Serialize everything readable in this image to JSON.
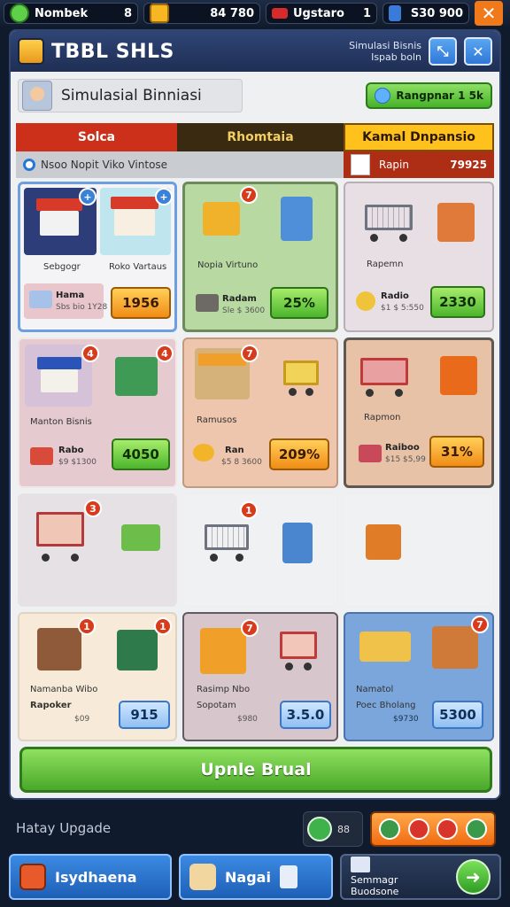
{
  "topbar": {
    "resource1": {
      "label": "Nombek",
      "value": "8"
    },
    "resource2": {
      "value": "84 780"
    },
    "resource3": {
      "label": "Ugstaro",
      "value": "1"
    },
    "resource4": {
      "value": "S30 900"
    },
    "close_glyph": "✕"
  },
  "header": {
    "title": "TBBL SHLS",
    "subtitle_line1": "Simulasi Bisnis",
    "subtitle_line2": "Ispab boln"
  },
  "sim": {
    "title": "Simulasial Binniasi",
    "manage_button": "Rangpnar 1 5k"
  },
  "tabs": [
    "Solca",
    "Rhomtaia",
    "Kamal Dnpansio"
  ],
  "filter": {
    "label": "Nsoo Nopit Viko Vintose"
  },
  "stat": {
    "label": "Rapin",
    "value": "79925"
  },
  "cards": [
    {
      "cap1": "Sebgogr",
      "cap2": "Roko Vartaus",
      "foot_title": "Hama",
      "foot_sub": "Sbs bio 1Y28",
      "price": "1956",
      "style": "orange"
    },
    {
      "cap1": "Nopia Virtuno",
      "foot_title": "Radam",
      "foot_sub": "Sle $ 3600",
      "price": "25%",
      "style": "green",
      "badge": "7"
    },
    {
      "cap1": "Rapemn",
      "foot_title": "Radio",
      "foot_sub": "$1 $ 5:550",
      "price": "2330",
      "style": "green"
    },
    {
      "cap1": "Manton Bisnis",
      "foot_title": "Rabo",
      "foot_sub": "$9 $1300",
      "price": "4050",
      "style": "green",
      "badge": "4"
    },
    {
      "cap1": "Ramusos",
      "foot_title": "Ran",
      "foot_sub": "$5 8 3600",
      "price": "209%",
      "style": "orange",
      "badge": "7"
    },
    {
      "cap1": "Rapmon",
      "foot_title": "Raiboo",
      "foot_sub": "$15 $5,99",
      "price": "31%",
      "style": "orange"
    },
    {
      "badge": "3"
    },
    {
      "badge": "1"
    },
    {},
    {
      "cap1": "Namanba Wibo",
      "cap2": "Rapoker",
      "foot_sub": "$09",
      "price": "915",
      "style": "blue",
      "badge": "1"
    },
    {
      "cap1": "Rasimp Nbo",
      "cap2": "Sopotam",
      "foot_sub": "$980",
      "price": "3.5.0",
      "style": "blue",
      "badge": "7"
    },
    {
      "cap1": "Namatol",
      "cap2": "Poec Bholang",
      "foot_sub": "$9730",
      "price": "5300",
      "style": "blue",
      "badge": "7"
    }
  ],
  "upgrade_button": "Upnle Brual",
  "bottom": {
    "history_label": "Hatay Upgade",
    "mini_value": "88"
  },
  "nav": [
    {
      "label": "Isydhaena"
    },
    {
      "label": "Nagai"
    },
    {
      "label": "Semmagr Buodsone"
    }
  ],
  "colors": {
    "accent_green": "#4cb52c",
    "accent_orange": "#f08c16",
    "accent_blue": "#2f78d8",
    "tab_red": "#cc2f1a"
  }
}
